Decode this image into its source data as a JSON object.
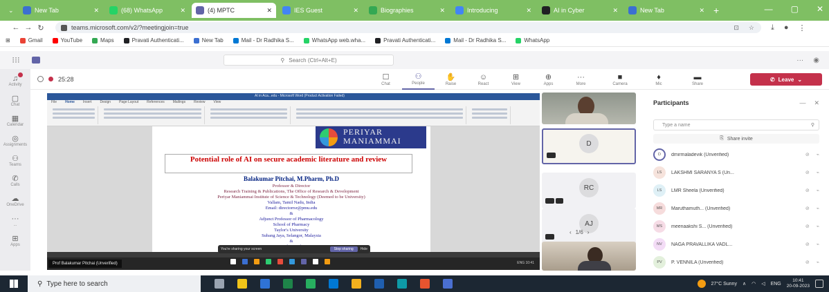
{
  "browser": {
    "tabs": [
      {
        "title": "New Tab",
        "color": "#3b6fd1"
      },
      {
        "title": "(68) WhatsApp",
        "color": "#25d366"
      },
      {
        "title": "(4) MPTC",
        "color": "#6264a7",
        "active": true
      },
      {
        "title": "IES Guest",
        "color": "#4285f4"
      },
      {
        "title": "Biographies",
        "color": "#34a853"
      },
      {
        "title": "Introducing",
        "color": "#4285f4"
      },
      {
        "title": "AI in Cyber",
        "color": "#202124"
      },
      {
        "title": "New Tab",
        "color": "#3b6fd1"
      }
    ],
    "url": "teams.microsoft.com/v2/?meetingjoin=true",
    "bookmarks": [
      {
        "label": "Gmail",
        "color": "#ea4335"
      },
      {
        "label": "YouTube",
        "color": "#ff0000"
      },
      {
        "label": "Maps",
        "color": "#34a853"
      },
      {
        "label": "Pravati Authenticati...",
        "color": "#202124"
      },
      {
        "label": "New Tab",
        "color": "#3b6fd1"
      },
      {
        "label": "Mail - Dr Radhika S...",
        "color": "#0078d4"
      },
      {
        "label": "WhatsApp web.wha...",
        "color": "#25d366"
      },
      {
        "label": "Pravati Authenticati...",
        "color": "#202124"
      },
      {
        "label": "Mail - Dr Radhika S...",
        "color": "#0078d4"
      },
      {
        "label": "WhatsApp",
        "color": "#25d366"
      }
    ]
  },
  "teams": {
    "search_placeholder": "Search (Ctrl+Alt+E)",
    "rail": [
      {
        "label": "Activity",
        "icon": "bell-icon",
        "glyph": "♫",
        "badge": true
      },
      {
        "label": "Chat",
        "icon": "chat-icon",
        "glyph": "▢"
      },
      {
        "label": "Calendar",
        "icon": "calendar-icon",
        "glyph": "▦"
      },
      {
        "label": "Assignments",
        "icon": "assignments-icon",
        "glyph": "◎"
      },
      {
        "label": "Teams",
        "icon": "teams-icon",
        "glyph": "⚇"
      },
      {
        "label": "Calls",
        "icon": "call-icon",
        "glyph": "✆"
      },
      {
        "label": "OneDrive",
        "icon": "cloud-icon",
        "glyph": "☁"
      },
      {
        "label": "...",
        "icon": "more-icon",
        "glyph": "···"
      },
      {
        "label": "Apps",
        "icon": "apps-icon",
        "glyph": "⊞"
      }
    ],
    "meeting_timer": "25:28",
    "controls": [
      {
        "label": "Chat",
        "icon": "chat-icon",
        "glyph": "☐"
      },
      {
        "label": "People",
        "icon": "people-icon",
        "glyph": "⚇",
        "active": true
      },
      {
        "label": "Raise",
        "icon": "raise-hand-icon",
        "glyph": "✋"
      },
      {
        "label": "React",
        "icon": "react-icon",
        "glyph": "☺"
      },
      {
        "label": "View",
        "icon": "view-icon",
        "glyph": "⊞"
      },
      {
        "label": "Apps",
        "icon": "apps-icon",
        "glyph": "⊕"
      },
      {
        "label": "More",
        "icon": "more-icon",
        "glyph": "···"
      }
    ],
    "av": [
      {
        "label": "Camera",
        "icon": "camera-icon",
        "glyph": "■"
      },
      {
        "label": "Mic",
        "icon": "mic-icon",
        "glyph": "♦"
      },
      {
        "label": "Share",
        "icon": "share-icon",
        "glyph": "▬"
      }
    ],
    "leave_label": "Leave",
    "tiles": [
      {
        "initials": "D"
      },
      {
        "initials": "RC"
      },
      {
        "initials": "AJ"
      }
    ],
    "pager": "1/6"
  },
  "shared_doc": {
    "window_title": "AI in Aca...edu - Microsoft Word (Product Activation Failed)",
    "ribbon_tabs": [
      "File",
      "Home",
      "Insert",
      "Design",
      "Page Layout",
      "References",
      "Mailings",
      "Review",
      "View"
    ],
    "logo_text": "PERIYAR MANIAMMAI",
    "title": "Potential role of AI on secure academic literature and review",
    "author": "Balakumar Pitchai, M.Pharm, Ph.D",
    "lines": [
      {
        "text": "Professor & Director",
        "style": "maroon"
      },
      {
        "text": "Research Training & Publications, The Office of Research & Development",
        "style": "maroon"
      },
      {
        "text": "Periyar Maniammai Institute of Science & Technology (Deemed to be University)",
        "style": "maroon"
      },
      {
        "text": "Vallam, Tamil Nadu, India",
        "style": ""
      },
      {
        "text": "Email: directorrsr@pmu.edu",
        "style": ""
      },
      {
        "text": "&",
        "style": "amp"
      },
      {
        "text": "Adjunct Professor of Pharmacology",
        "style": ""
      },
      {
        "text": "School of Pharmacy",
        "style": ""
      },
      {
        "text": "Taylor's University",
        "style": ""
      },
      {
        "text": "Subang Jaya, Selangor, Malaysia",
        "style": ""
      },
      {
        "text": "&",
        "style": "amp"
      },
      {
        "text": "Consulting Editor",
        "style": ""
      }
    ],
    "sharing_notice": "You're sharing your screen",
    "stop_sharing": "Stop sharing",
    "hide": "Hide",
    "presenter": "Prof Balakumar Pitchai (Unverified)",
    "inner_tray": "ENG 10:41",
    "inner_taskbar_colors": [
      "#ffffff",
      "#3b6fd1",
      "#f39c12",
      "#2ecc71",
      "#e74c3c",
      "#3498db",
      "#6264a7",
      "#ffffff",
      "#f39c12"
    ]
  },
  "participants": {
    "title": "Participants",
    "search_placeholder": "Type a name",
    "share_invite": "Share invite",
    "list": [
      {
        "initials": "D",
        "name": "dmirmaladevik (Unverified)",
        "color": "#ffffff"
      },
      {
        "initials": "LS",
        "name": "LAKSHMI SARANYA S (Un...",
        "color": "#f6e3dc"
      },
      {
        "initials": "LS",
        "name": "LMR Sheela (Unverified)",
        "color": "#dff0f6"
      },
      {
        "initials": "MR",
        "name": "Maruthamuth... (Unverified)",
        "color": "#f6dcdc"
      },
      {
        "initials": "MS",
        "name": "meenaakshi S... (Unverified)",
        "color": "#f6dce6"
      },
      {
        "initials": "NV",
        "name": "NAGA PRAVALLIKA VADL...",
        "color": "#f3dcf6"
      },
      {
        "initials": "PV",
        "name": "P. VENNILA (Unverified)",
        "color": "#e3f0dc"
      }
    ]
  },
  "taskbar": {
    "search_placeholder": "Type here to search",
    "apps": [
      "#9aa4b1",
      "#f0c419",
      "#2f73d6",
      "#1e8449",
      "#27ae60",
      "#0078d4",
      "#f2b01e",
      "#1f5fb0",
      "#0e9aa7",
      "#e8542f",
      "#4a6fd1"
    ],
    "weather": "27°C Sunny",
    "time": "10:41",
    "date": "20-09-2023",
    "lang": "ENG"
  }
}
